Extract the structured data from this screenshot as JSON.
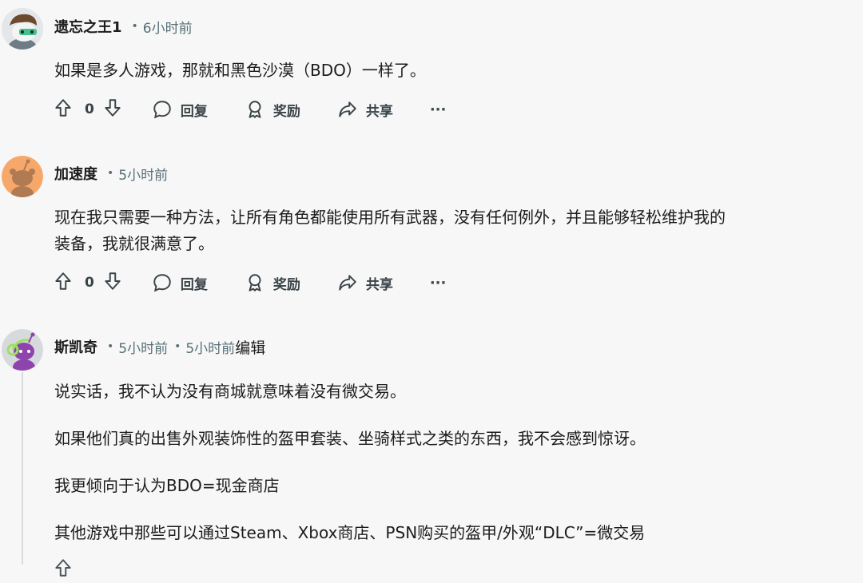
{
  "comments": [
    {
      "author": "遗忘之王1",
      "time": "6小时前",
      "lines": [
        "如果是多人游戏，那就和黑色沙漠（BDO）一样了。"
      ],
      "votes": "0"
    },
    {
      "author": "加速度",
      "time": "5小时前",
      "lines": [
        "现在我只需要一种方法，让所有角色都能使用所有武器，没有任何例外，并且能够轻松维护我的",
        "装备，我就很满意了。"
      ],
      "votes": "0"
    },
    {
      "author": "斯凯奇",
      "time": "5小时前",
      "edit_time": "5小时前",
      "edited_label": "编辑",
      "paragraphs": [
        "说实话，我不认为没有商城就意味着没有微交易。",
        "如果他们真的出售外观装饰性的盔甲套装、坐骑样式之类的东西，我不会感到惊讶。",
        "我更倾向于认为BDO=现金商店",
        "其他游戏中那些可以通过Steam、Xbox商店、PSN购买的盔甲/外观“DLC”=微交易"
      ]
    }
  ],
  "actions": {
    "reply": "回复",
    "award": "奖励",
    "share": "共享",
    "more": "···"
  },
  "icons": [
    "upvote-icon",
    "downvote-icon",
    "reply-bubble-icon",
    "award-icon",
    "share-icon",
    "more-icon"
  ],
  "colors": {
    "background": "#f7f7f7",
    "meta_gray": "#576f76",
    "text": "#1c1c1c"
  }
}
